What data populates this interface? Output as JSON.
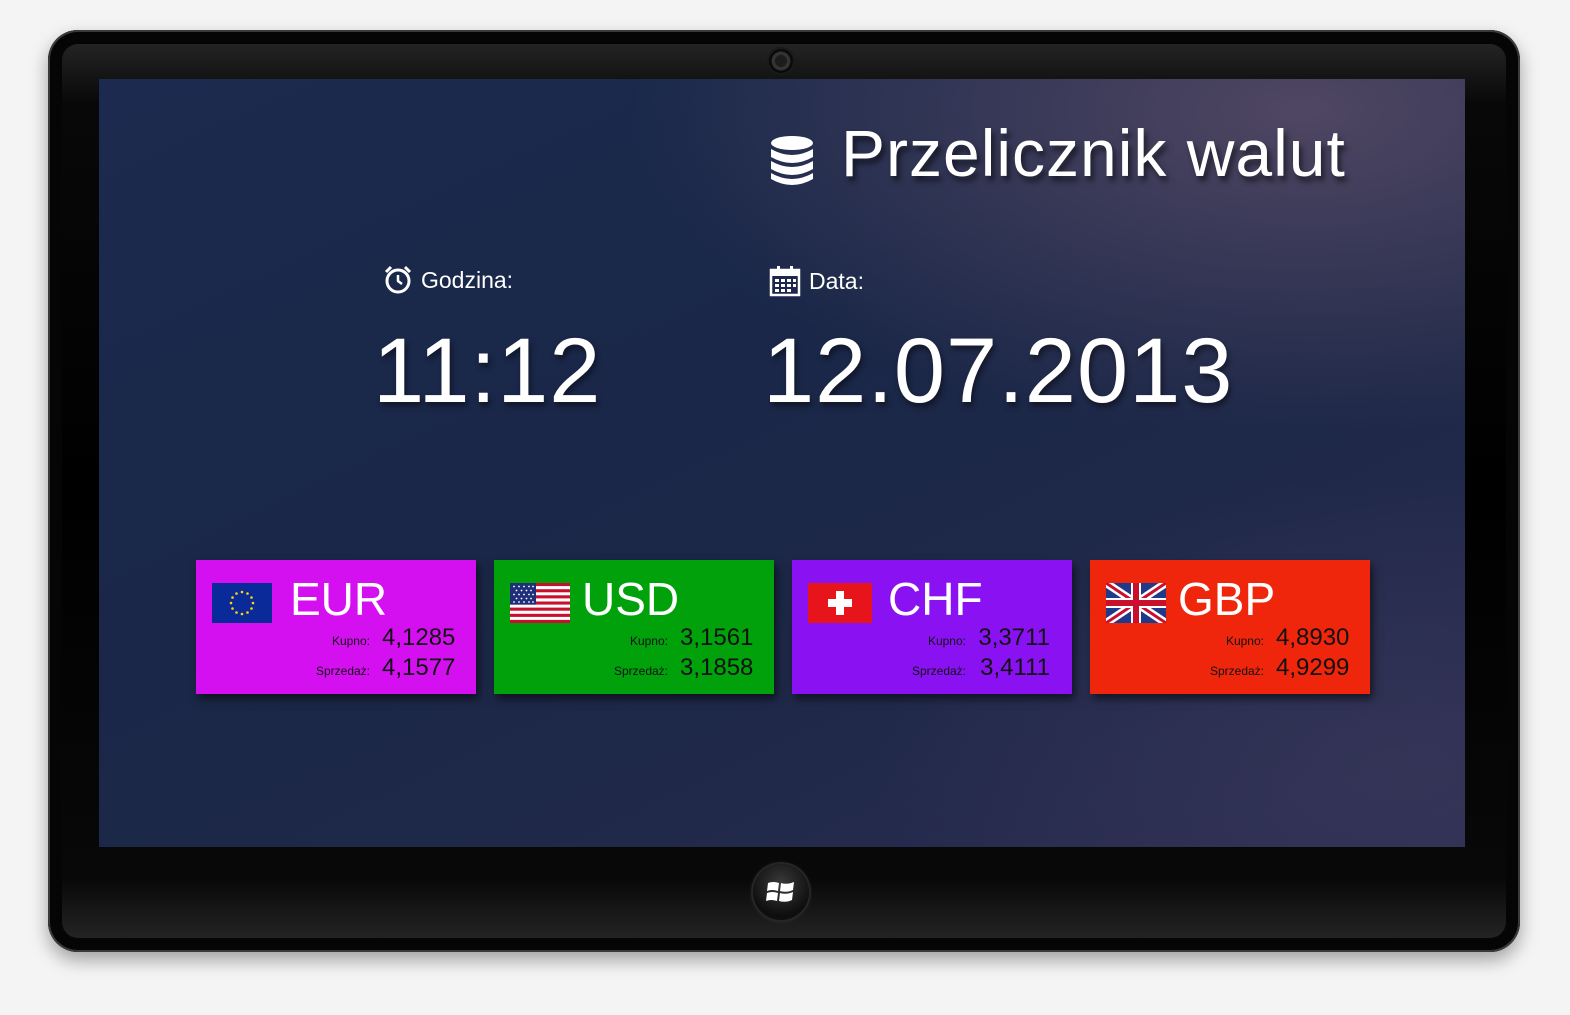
{
  "app": {
    "title": "Przelicznik walut",
    "title_icon": "database-icon"
  },
  "clock": {
    "label": "Godzina:",
    "icon": "alarm-clock-icon",
    "value": "11:12"
  },
  "date": {
    "label": "Data:",
    "icon": "calendar-icon",
    "value": "12.07.2013"
  },
  "currencies": [
    {
      "code": "EUR",
      "flag": "eu-flag-icon",
      "color": "#d510f0",
      "buy_label": "Kupno:",
      "buy": "4,1285",
      "sell_label": "Sprzedaż:",
      "sell": "4,1577"
    },
    {
      "code": "USD",
      "flag": "us-flag-icon",
      "color": "#00a10b",
      "buy_label": "Kupno:",
      "buy": "3,1561",
      "sell_label": "Sprzedaż:",
      "sell": "3,1858"
    },
    {
      "code": "CHF",
      "flag": "swiss-flag-icon",
      "color": "#8a12f2",
      "buy_label": "Kupno:",
      "buy": "3,3711",
      "sell_label": "Sprzedaż:",
      "sell": "3,4111"
    },
    {
      "code": "GBP",
      "flag": "uk-flag-icon",
      "color": "#f0260c",
      "buy_label": "Kupno:",
      "buy": "4,8930",
      "sell_label": "Sprzedaż:",
      "sell": "4,9299"
    }
  ],
  "device": {
    "home_button_icon": "windows-logo-icon",
    "camera_icon": "camera-icon"
  }
}
